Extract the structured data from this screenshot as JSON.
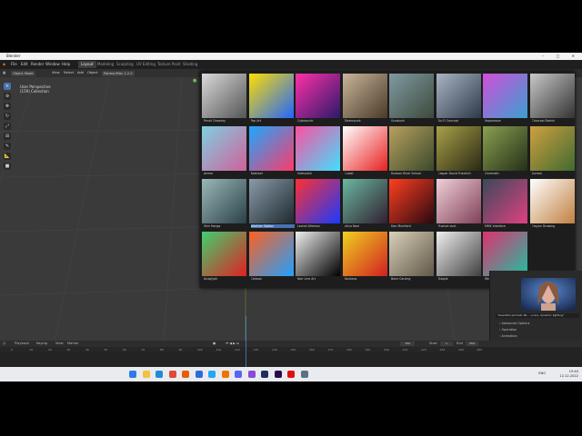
{
  "window": {
    "title": "Blender",
    "controls": [
      "–",
      "□",
      "✕"
    ]
  },
  "menu": {
    "items": [
      "File",
      "Edit",
      "Render",
      "Window",
      "Help"
    ],
    "tabs": [
      {
        "label": "Layout",
        "active": true
      },
      {
        "label": "Modeling",
        "active": false
      },
      {
        "label": "Sculpting",
        "active": false
      },
      {
        "label": "UV Editing",
        "active": false
      },
      {
        "label": "Texture Paint",
        "active": false
      },
      {
        "label": "Shading",
        "active": false
      }
    ]
  },
  "viewport_header": {
    "mode": "Object Mode",
    "menus": [
      "View",
      "Select",
      "Add",
      "Object"
    ],
    "addon": "PatreonPlan 1.2.0"
  },
  "viewport": {
    "perspective": "User Perspective",
    "collection": "(159) Collection"
  },
  "gallery": {
    "items": [
      {
        "label": "Pencil Drawing",
        "c1": "#d9d9d9",
        "c2": "#555555"
      },
      {
        "label": "Pop Art",
        "c1": "#ffde00",
        "c2": "#2266ff"
      },
      {
        "label": "Cyberpunk",
        "c1": "#ff2fa8",
        "c2": "#2a1a6a"
      },
      {
        "label": "Steampunk",
        "c1": "#c8b59a",
        "c2": "#4a3a28"
      },
      {
        "label": "Scorpunk",
        "c1": "#7f9aa2",
        "c2": "#3e4a3c"
      },
      {
        "label": "Sci-Fi Concept",
        "c1": "#a8b4c2",
        "c2": "#2e3a4a"
      },
      {
        "label": "Vaporwave",
        "c1": "#d04fd8",
        "c2": "#3aa0d0"
      },
      {
        "label": "Charcoal Sketch",
        "c1": "#c8c8c8",
        "c2": "#333333"
      },
      {
        "label": "Anime",
        "c1": "#7fd0e0",
        "c2": "#d0609a"
      },
      {
        "label": "Abstract",
        "c1": "#1aa8ff",
        "c2": "#ff3a6a"
      },
      {
        "label": "Iridescent",
        "c1": "#ff4fa0",
        "c2": "#40e0ff"
      },
      {
        "label": "Cubist",
        "c1": "#ffffff",
        "c2": "#e82020"
      },
      {
        "label": "Hudson River School",
        "c1": "#b8a060",
        "c2": "#3a4a2a"
      },
      {
        "label": "Caspar David Friedrich",
        "c1": "#a8a048",
        "c2": "#2a2a14"
      },
      {
        "label": "Cinematic",
        "c1": "#8aa050",
        "c2": "#243018"
      },
      {
        "label": "Surreal",
        "c1": "#d0a040",
        "c2": "#406a30"
      },
      {
        "label": "Shin Hanga",
        "c1": "#9ab8b8",
        "c2": "#2a4048"
      },
      {
        "label": "Weather Station",
        "c1": "#8a9aa8",
        "c2": "#1e2a30"
      },
      {
        "label": "Leonid Afremov",
        "c1": "#ff3030",
        "c2": "#1a3aff"
      },
      {
        "label": "Vicco Noel",
        "c1": "#6ab8a0",
        "c2": "#302030"
      },
      {
        "label": "Dan Mumford",
        "c1": "#ff4020",
        "c2": "#2a0810"
      },
      {
        "label": "Product shot",
        "c1": "#f0d0d8",
        "c2": "#804058"
      },
      {
        "label": "MMX Interface",
        "c1": "#3a4a5a",
        "c2": "#e04080"
      },
      {
        "label": "Crayon Drawing",
        "c1": "#ffffff",
        "c2": "#c08040"
      },
      {
        "label": "Anaglyph",
        "c1": "#40d070",
        "c2": "#e02020"
      },
      {
        "label": "Cartoon",
        "c1": "#ff6020",
        "c2": "#20a0ff"
      },
      {
        "label": "Noir Line Art",
        "c1": "#f0f0f0",
        "c2": "#000000"
      },
      {
        "label": "Bauhaus",
        "c1": "#f0d020",
        "c2": "#d02020"
      },
      {
        "label": "Bone Carving",
        "c1": "#d8d0b8",
        "c2": "#605848"
      },
      {
        "label": "Stipple",
        "c1": "#f0f0f0",
        "c2": "#404040"
      },
      {
        "label": "Whirlwindow",
        "c1": "#e03070",
        "c2": "#20c0a0"
      }
    ],
    "selected_label": "Weather Station"
  },
  "side_panel": {
    "prompt": "\"beautiful portrait, 8k, ...ucius, dynamic lighting\"",
    "expanders": [
      "Advanced Options",
      "Operation",
      "Animation"
    ],
    "version": "0.0.0"
  },
  "timeline": {
    "menus": [
      "Playback",
      "Keying",
      "View",
      "Marker"
    ],
    "current_frame": "159",
    "start_label": "Start",
    "start": "1",
    "end_label": "End",
    "end": "250",
    "ruler_ticks": [
      "0",
      "10",
      "20",
      "30",
      "40",
      "50",
      "60",
      "70",
      "80",
      "90",
      "100",
      "110",
      "120",
      "130",
      "140",
      "150",
      "160",
      "170",
      "180",
      "190",
      "200",
      "210",
      "220",
      "230",
      "240",
      "250"
    ]
  },
  "taskbar": {
    "icons": [
      {
        "name": "windows-start-icon",
        "color": "#2b7de9"
      },
      {
        "name": "file-explorer-icon",
        "color": "#f2c240"
      },
      {
        "name": "edge-icon",
        "color": "#1e8cd8"
      },
      {
        "name": "chrome-icon",
        "color": "#dd4b39"
      },
      {
        "name": "firefox-icon",
        "color": "#e66000"
      },
      {
        "name": "messenger-icon",
        "color": "#2e6bd8"
      },
      {
        "name": "vscode-icon",
        "color": "#23a9f2"
      },
      {
        "name": "blender-icon",
        "color": "#ea7600"
      },
      {
        "name": "discord-icon",
        "color": "#5865f2"
      },
      {
        "name": "visual-studio-icon",
        "color": "#8a4bd8"
      },
      {
        "name": "photoshop-icon",
        "color": "#1f2e5c"
      },
      {
        "name": "premiere-icon",
        "color": "#2a0a4a"
      },
      {
        "name": "youtube-icon",
        "color": "#e01010"
      },
      {
        "name": "settings-icon",
        "color": "#607080"
      }
    ],
    "lang": "ENG",
    "time": "19:40",
    "date": "12.12.2022"
  }
}
